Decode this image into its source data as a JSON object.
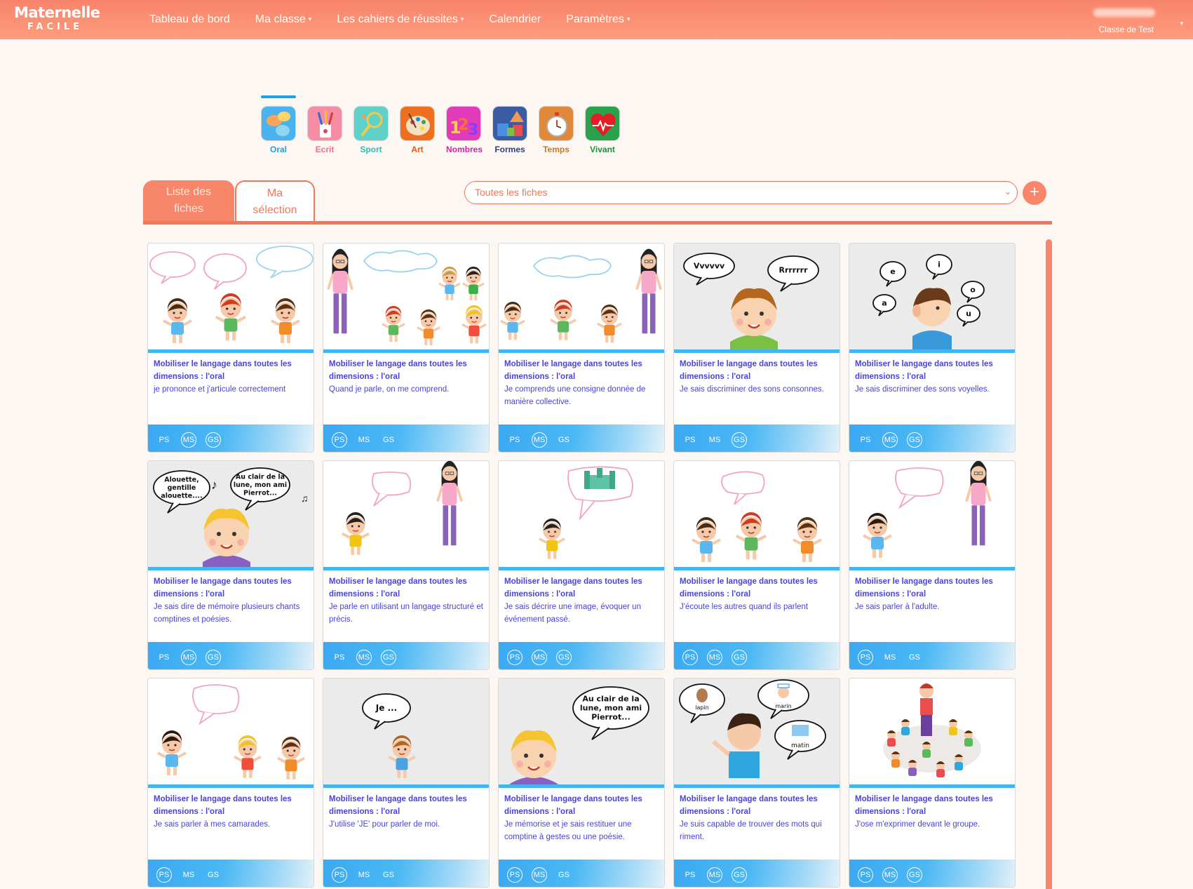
{
  "header": {
    "logo_line1": "Maternelle",
    "logo_line2": "FACILE",
    "nav": [
      {
        "label": "Tableau de bord",
        "dropdown": false
      },
      {
        "label": "Ma classe",
        "dropdown": true
      },
      {
        "label": "Les cahiers de réussites",
        "dropdown": true
      },
      {
        "label": "Calendrier",
        "dropdown": false
      },
      {
        "label": "Paramètres",
        "dropdown": true
      }
    ],
    "class_name": "Classe de Test",
    "caret": "▾"
  },
  "domains": [
    {
      "label": "Oral",
      "color": "#1aa3e0",
      "icon": "speech-bubbles-icon",
      "active": true
    },
    {
      "label": "Ecrit",
      "color": "#f0708c",
      "icon": "pencil-cup-icon",
      "active": false
    },
    {
      "label": "Sport",
      "color": "#2bbdb0",
      "icon": "racket-icon",
      "active": false
    },
    {
      "label": "Art",
      "color": "#e2590e",
      "icon": "palette-icon",
      "active": false
    },
    {
      "label": "Nombres",
      "color": "#d622a8",
      "icon": "numbers-icon",
      "active": false
    },
    {
      "label": "Formes",
      "color": "#2b3f86",
      "icon": "shapes-icon",
      "active": false
    },
    {
      "label": "Temps",
      "color": "#c47a25",
      "icon": "stopwatch-icon",
      "active": false
    },
    {
      "label": "Vivant",
      "color": "#1d8e3e",
      "icon": "heart-icon",
      "active": false
    }
  ],
  "tabs": {
    "list_line1": "Liste des",
    "list_line2": "fiches",
    "selection_line1": "Ma",
    "selection_line2": "sélection"
  },
  "filter": {
    "selected": "Toutes les fiches",
    "chevron": "⌄"
  },
  "add_label": "+",
  "cards": [
    {
      "title": "Mobiliser le langage dans toutes les dimensions : l'oral",
      "desc": "je prononce et j'articule correctement",
      "levels": {
        "PS": false,
        "MS": true,
        "GS": true
      },
      "scene": "three-kids-bubbles"
    },
    {
      "title": "Mobiliser le langage dans toutes les dimensions : l'oral",
      "desc": "Quand je parle, on me comprend.",
      "levels": {
        "PS": true,
        "MS": false,
        "GS": false
      },
      "scene": "teacher-group"
    },
    {
      "title": "Mobiliser le langage dans toutes les dimensions : l'oral",
      "desc": "Je comprends une consigne donnée de manière collective.",
      "levels": {
        "PS": false,
        "MS": true,
        "GS": false
      },
      "scene": "group-teacher"
    },
    {
      "title": "Mobiliser le langage dans toutes les dimensions : l'oral",
      "desc": "Je sais discriminer des sons consonnes.",
      "levels": {
        "PS": false,
        "MS": false,
        "GS": true
      },
      "scene": "consonants",
      "bubbles": [
        "Vvvvvv",
        "Rrrrrrr"
      ]
    },
    {
      "title": "Mobiliser le langage dans toutes les dimensions : l'oral",
      "desc": "Je sais discriminer des sons voyelles.",
      "levels": {
        "PS": false,
        "MS": true,
        "GS": true
      },
      "scene": "vowels",
      "bubbles": [
        "e",
        "i",
        "o",
        "a",
        "u"
      ]
    },
    {
      "title": "Mobiliser le langage dans toutes les dimensions : l'oral",
      "desc": "Je sais dire de mémoire plusieurs chants comptines et poésies.",
      "levels": {
        "PS": false,
        "MS": true,
        "GS": true
      },
      "scene": "songs",
      "bubbles": [
        "Alouette, gentille alouette...",
        "Au clair de la lune, mon ami Pierrot..."
      ]
    },
    {
      "title": "Mobiliser le langage dans toutes les dimensions : l'oral",
      "desc": "Je parle en utilisant un langage structuré et précis.",
      "levels": {
        "PS": false,
        "MS": true,
        "GS": true
      },
      "scene": "boy-teacher"
    },
    {
      "title": "Mobiliser le langage dans toutes les dimensions : l'oral",
      "desc": "Je sais décrire une image, évoquer un événement passé.",
      "levels": {
        "PS": true,
        "MS": true,
        "GS": true
      },
      "scene": "boy-castle"
    },
    {
      "title": "Mobiliser le langage dans toutes les dimensions : l'oral",
      "desc": "J'écoute les autres quand ils parlent",
      "levels": {
        "PS": true,
        "MS": true,
        "GS": true
      },
      "scene": "three-kids-one-bubble"
    },
    {
      "title": "Mobiliser le langage dans toutes les dimensions : l'oral",
      "desc": "Je sais parler à l'adulte.",
      "levels": {
        "PS": true,
        "MS": false,
        "GS": false
      },
      "scene": "girl-teacher"
    },
    {
      "title": "Mobiliser le langage dans toutes les dimensions : l'oral",
      "desc": "Je sais parler à mes camarades.",
      "levels": {
        "PS": true,
        "MS": false,
        "GS": false
      },
      "scene": "girl-kids"
    },
    {
      "title": "Mobiliser le langage dans toutes les dimensions : l'oral",
      "desc": "J'utilise 'JE' pour parler de moi.",
      "levels": {
        "PS": true,
        "MS": false,
        "GS": false
      },
      "scene": "je",
      "bubbles": [
        "Je ..."
      ]
    },
    {
      "title": "Mobiliser le langage dans toutes les dimensions : l'oral",
      "desc": "Je mémorise et je sais restituer une comptine à gestes ou une poésie.",
      "levels": {
        "PS": true,
        "MS": true,
        "GS": false
      },
      "scene": "poem",
      "bubbles": [
        "Au clair de la lune, mon ami Pierrot..."
      ]
    },
    {
      "title": "Mobiliser le langage dans toutes les dimensions : l'oral",
      "desc": "Je suis capable de trouver des mots qui riment.",
      "levels": {
        "PS": false,
        "MS": true,
        "GS": true
      },
      "scene": "rhymes",
      "bubbles": [
        "lapin",
        "marin",
        "matin"
      ]
    },
    {
      "title": "Mobiliser le langage dans toutes les dimensions : l'oral",
      "desc": "J'ose m'exprimer devant le groupe.",
      "levels": {
        "PS": true,
        "MS": true,
        "GS": true
      },
      "scene": "circle"
    }
  ],
  "level_names": [
    "PS",
    "MS",
    "GS"
  ]
}
